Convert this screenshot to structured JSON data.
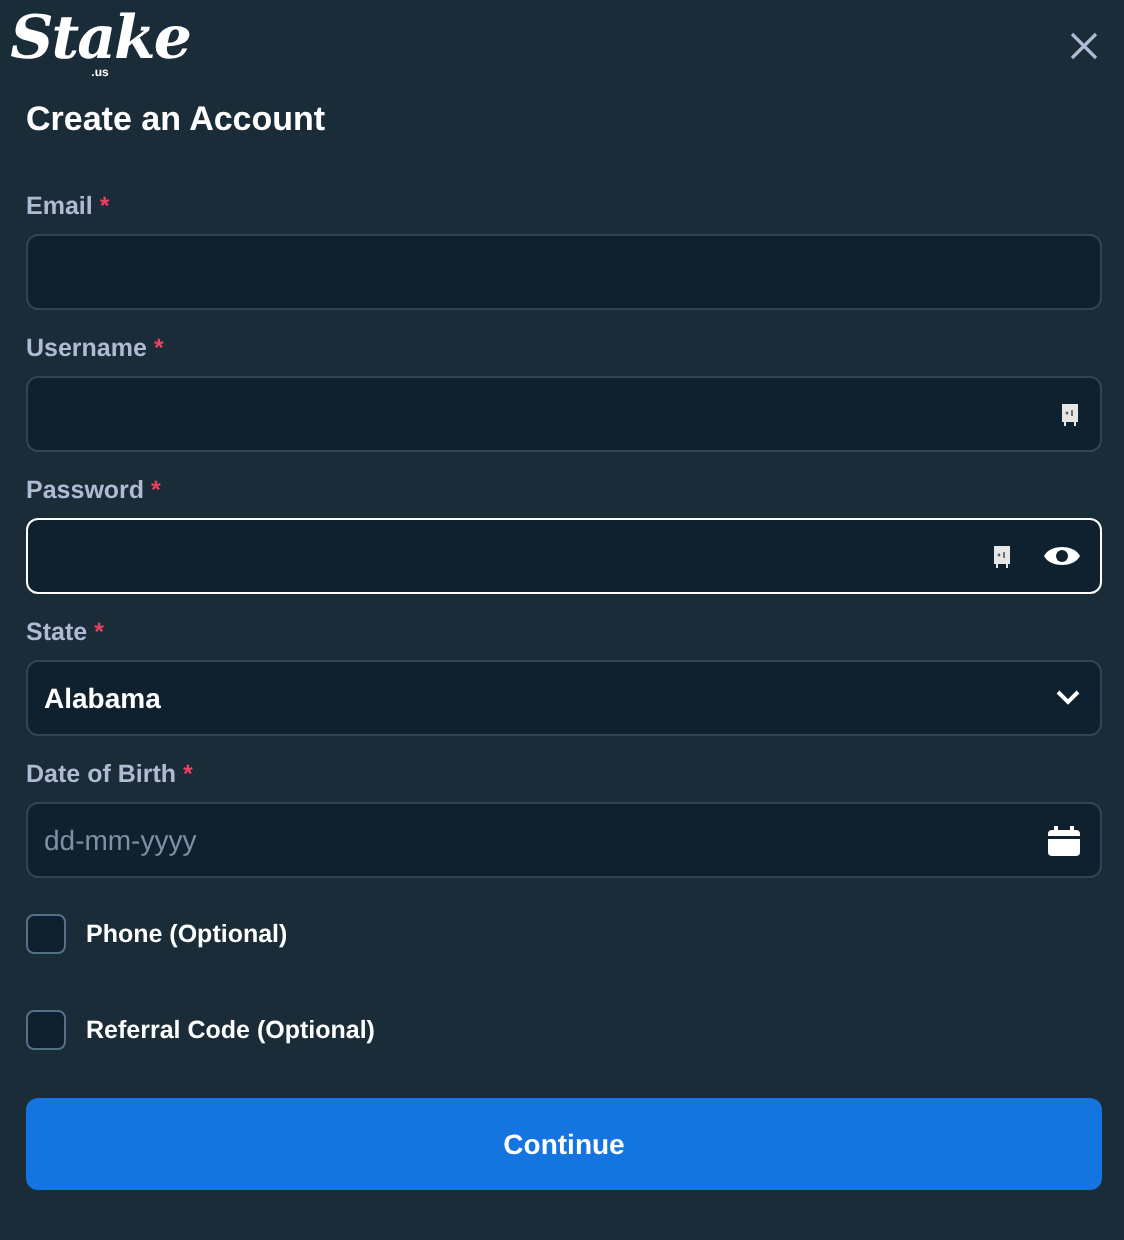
{
  "logo": {
    "name": "Stake",
    "suffix": ".us"
  },
  "title": "Create an Account",
  "fields": [
    {
      "kind": "text",
      "label": "Email",
      "marker": "*",
      "focused": false,
      "keychain": false
    },
    {
      "kind": "text",
      "label": "Username",
      "marker": "*",
      "focused": false,
      "keychain": true
    },
    {
      "kind": "password",
      "label": "Password",
      "marker": "*",
      "focused": true,
      "keychain": true
    },
    {
      "kind": "select",
      "label": "State",
      "marker": "*",
      "focused": false,
      "keychain": false,
      "value": "Alabama"
    },
    {
      "kind": "date",
      "label": "Date of Birth",
      "marker": "*",
      "focused": false,
      "keychain": false,
      "placeholder": "dd-mm-yyyy"
    }
  ],
  "options": [
    {
      "label": "Phone (Optional)",
      "checked": false
    },
    {
      "label": "Referral Code (Optional)",
      "checked": false
    }
  ],
  "button": "Continue"
}
